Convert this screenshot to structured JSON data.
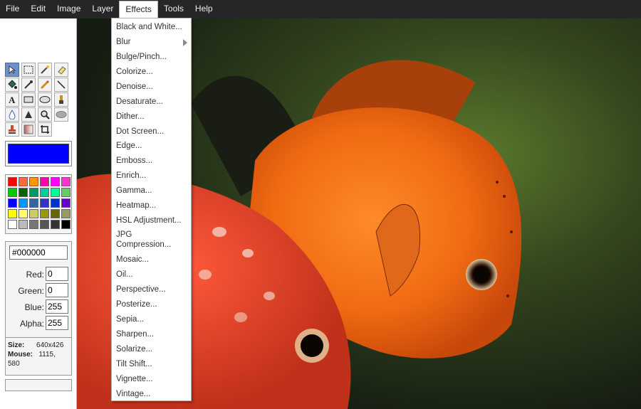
{
  "menubar": {
    "items": [
      "File",
      "Edit",
      "Image",
      "Layer",
      "Effects",
      "Tools",
      "Help"
    ],
    "active": "Effects"
  },
  "effects_menu": {
    "items": [
      "Black and White...",
      "Blur",
      "Bulge/Pinch...",
      "Colorize...",
      "Denoise...",
      "Desaturate...",
      "Dither...",
      "Dot Screen...",
      "Edge...",
      "Emboss...",
      "Enrich...",
      "Gamma...",
      "Heatmap...",
      "HSL Adjustment...",
      "JPG Compression...",
      "Mosaic...",
      "Oil...",
      "Perspective...",
      "Posterize...",
      "Sepia...",
      "Sharpen...",
      "Solarize...",
      "Tilt Shift...",
      "Vignette...",
      "Vintage..."
    ],
    "jpg_line1": "JPG",
    "jpg_line2": "Compression..."
  },
  "tools": [
    "select-tool",
    "marquee-tool",
    "magic-wand-tool",
    "eraser-tool",
    "fill-tool",
    "eyedropper-tool",
    "pencil-tool",
    "line-tool",
    "text-tool",
    "rectangle-tool",
    "ellipse-tool",
    "brush-tool",
    "blur-tool",
    "sharpen-tool",
    "zoom-tool",
    "smudge-tool",
    "clone-stamp-tool",
    "gradient-tool",
    "crop-tool"
  ],
  "primary_color": "#0000ff",
  "palette": [
    "#ff0000",
    "#ff6a3d",
    "#ff9900",
    "#ff00aa",
    "#ff00ff",
    "#ff33cc",
    "#00cc00",
    "#006600",
    "#009966",
    "#00cc99",
    "#00ff99",
    "#66cc66",
    "#0000ff",
    "#0099ff",
    "#336699",
    "#3333cc",
    "#0033cc",
    "#6600cc",
    "#ffff00",
    "#ffff66",
    "#cccc66",
    "#999900",
    "#666600",
    "#999966",
    "#ffffff",
    "#bbbbbb",
    "#777777",
    "#555555",
    "#333333",
    "#000000"
  ],
  "color": {
    "hex": "#000000",
    "red_label": "Red:",
    "red": "0",
    "green_label": "Green:",
    "green": "0",
    "blue_label": "Blue:",
    "blue": "255",
    "alpha_label": "Alpha:",
    "alpha": "255"
  },
  "info": {
    "size_label": "Size:",
    "size_value": "640x426",
    "mouse_label": "Mouse:",
    "mouse_value": "1115,",
    "mouse_value2": "580"
  }
}
